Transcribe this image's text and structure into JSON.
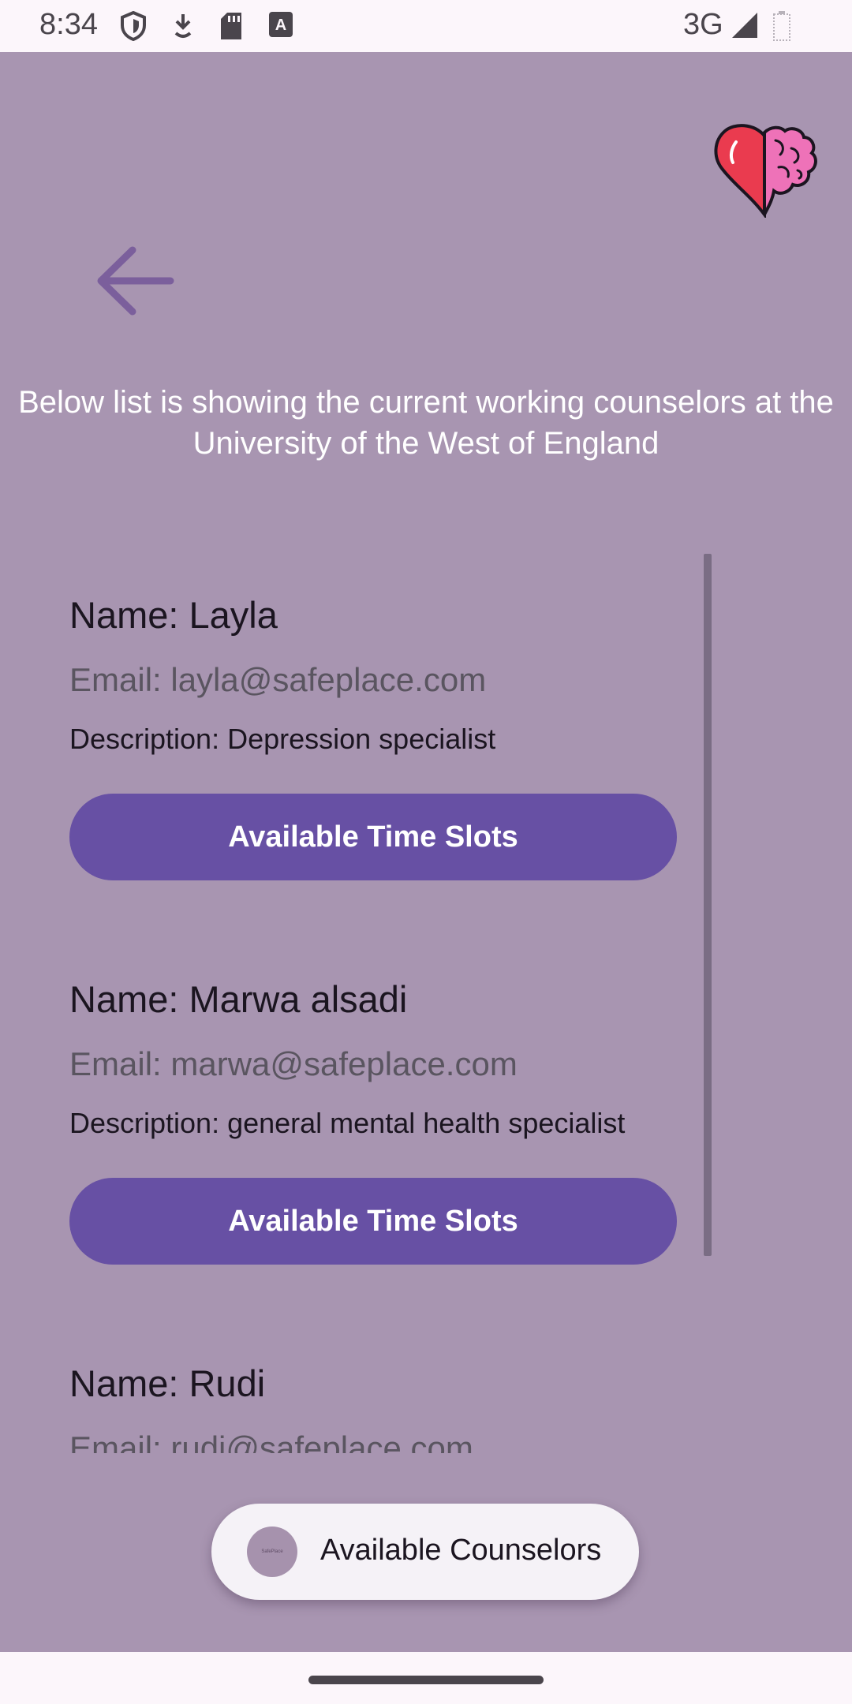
{
  "status_bar": {
    "time": "8:34",
    "network": "3G",
    "icons": [
      "shield-icon",
      "download-icon",
      "sd-card-icon",
      "keyboard-a-icon",
      "signal-icon",
      "battery-icon"
    ]
  },
  "header": {
    "back_icon": "arrow-back-icon",
    "logo": "heart-brain-logo"
  },
  "intro_text": "Below list is showing the current working counselors at the University of the West of England",
  "counselors": [
    {
      "name": "Name: Layla",
      "email": "Email: layla@safeplace.com",
      "description": "Description: Depression specialist",
      "button_label": "Available Time Slots"
    },
    {
      "name": "Name: Marwa alsadi",
      "email": "Email: marwa@safeplace.com",
      "description": "Description: general mental health specialist",
      "button_label": "Available Time Slots"
    },
    {
      "name": "Name: Rudi",
      "email": "Email: rudi@safeplace.com"
    }
  ],
  "fab": {
    "label": "Available Counselors",
    "avatar_text": "SafePlace"
  },
  "colors": {
    "background": "#a895b1",
    "button": "#6750a4",
    "button_text": "#ffffff",
    "fab_background": "#f5f2f7"
  }
}
